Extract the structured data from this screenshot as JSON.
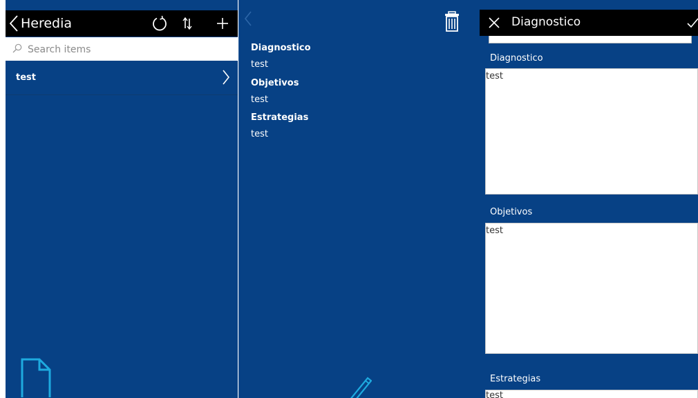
{
  "browse": {
    "title": "Heredia",
    "search_placeholder": "Search items",
    "items": [
      {
        "label": "test"
      }
    ]
  },
  "detail": {
    "fields": [
      {
        "title": "Diagnostico",
        "value": "test"
      },
      {
        "title": "Objetivos",
        "value": "test"
      },
      {
        "title": "Estrategias",
        "value": "test"
      }
    ]
  },
  "edit": {
    "title": "Diagnostico",
    "fields": [
      {
        "label": "Diagnostico",
        "value": "test"
      },
      {
        "label": "Objetivos",
        "value": "test"
      },
      {
        "label": "Estrategias",
        "value": "test"
      }
    ]
  },
  "colors": {
    "panel_bg": "#074185",
    "header_bg": "#000000",
    "accent": "#1eaadf"
  },
  "icons": [
    "back-chevron-icon",
    "refresh-icon",
    "sort-icon",
    "add-icon",
    "search-icon",
    "chevron-right-icon",
    "document-icon",
    "delete-icon",
    "edit-pencil-icon",
    "close-icon",
    "checkmark-icon"
  ]
}
